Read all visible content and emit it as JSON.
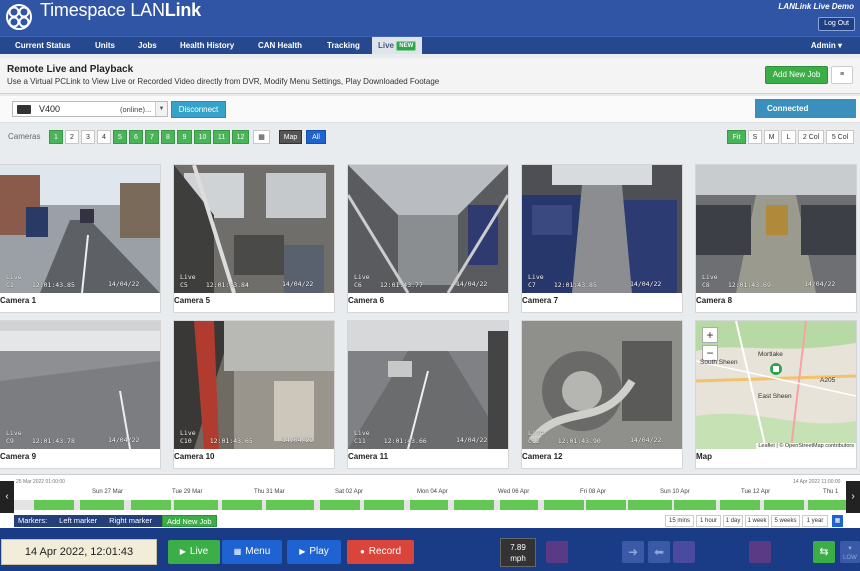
{
  "header": {
    "brand_prefix": "Timespace LAN",
    "brand_suffix": "Link",
    "demo_label": "LANLink Live Demo",
    "logout_label": "Log Out"
  },
  "nav": {
    "items": [
      "Current Status",
      "Units",
      "Jobs",
      "Health History",
      "CAN Health",
      "Tracking"
    ],
    "active_label": "Live",
    "active_badge": "NEW",
    "admin_label": "Admin ▾"
  },
  "page": {
    "title": "Remote Live and Playback",
    "subtitle": "Use a Virtual PCLink to View Live or Recorded Video directly from DVR, Modify Menu Settings, Play Downloaded Footage",
    "add_job_label": "Add New Job",
    "options_label": "≡"
  },
  "device": {
    "name": "V400",
    "status": "(online)...",
    "disconnect_label": "Disconnect",
    "connection_status": "Connected"
  },
  "cameras_bar": {
    "label": "Cameras",
    "numbers": [
      "1",
      "2",
      "3",
      "4",
      "5",
      "6",
      "7",
      "8",
      "9",
      "10",
      "11",
      "12"
    ],
    "active_numbers": [
      "1",
      "5",
      "6",
      "7",
      "8",
      "9",
      "10",
      "11",
      "12"
    ],
    "map_label": "Map",
    "all_label": "All",
    "sizes": [
      "Fit",
      "S",
      "M",
      "L",
      "2 Col",
      "5 Col"
    ],
    "active_size": "Fit"
  },
  "tiles": [
    {
      "caption": "Camera 1",
      "osd_live": "Live",
      "osd_ch": "C1",
      "osd_time": "12:01:43.85",
      "osd_date": "14/04/22"
    },
    {
      "caption": "Camera 5",
      "osd_live": "Live",
      "osd_ch": "C5",
      "osd_time": "12:01:43.84",
      "osd_date": "14/04/22"
    },
    {
      "caption": "Camera 6",
      "osd_live": "Live",
      "osd_ch": "C6",
      "osd_time": "12:01:43.77",
      "osd_date": "14/04/22"
    },
    {
      "caption": "Camera 7",
      "osd_live": "Live",
      "osd_ch": "C7",
      "osd_time": "12:01:43.85",
      "osd_date": "14/04/22"
    },
    {
      "caption": "Camera 8",
      "osd_live": "Live",
      "osd_ch": "C8",
      "osd_time": "12:01:43.69",
      "osd_date": "14/04/22"
    },
    {
      "caption": "Camera 9",
      "osd_live": "Live",
      "osd_ch": "C9",
      "osd_time": "12:01:43.78",
      "osd_date": "14/04/22"
    },
    {
      "caption": "Camera 10",
      "osd_live": "Live",
      "osd_ch": "C10",
      "osd_time": "12:01:43.65",
      "osd_date": "14/04/22"
    },
    {
      "caption": "Camera 11",
      "osd_live": "Live",
      "osd_ch": "C11",
      "osd_time": "12:01:43.66",
      "osd_date": "14/04/22"
    },
    {
      "caption": "Camera 12",
      "osd_live": "Live",
      "osd_ch": "C12",
      "osd_time": "12:01:43.90",
      "osd_date": "14/04/22"
    },
    {
      "caption": "Map"
    }
  ],
  "map": {
    "labels": [
      "Mortlake",
      "East Sheen",
      "South Sheen",
      "A205"
    ],
    "attribution": "Leaflet | © OpenStreetMap contributors"
  },
  "timeline": {
    "start_small": "25 Mar 2022 01:00:00",
    "end_small": "14 Apr 2022 11:00:00",
    "ticks": [
      "Sun 27 Mar",
      "Tue 29 Mar",
      "Thu 31 Mar",
      "Sat 02 Apr",
      "Mon 04 Apr",
      "Wed 06 Apr",
      "Fri 08 Apr",
      "Sun 10 Apr",
      "Tue 12 Apr",
      "Thu 1"
    ],
    "prev_label": "‹",
    "next_label": "›"
  },
  "markers": {
    "label": "Markers:",
    "left": "Left marker",
    "right": "Right marker",
    "add_job": "Add New Job"
  },
  "ranges": [
    "15 mins",
    "1 hour",
    "1 day",
    "1 week",
    "5 weeks",
    "1 year"
  ],
  "footer": {
    "datetime": "14 Apr 2022, 12:01:43",
    "live_label": "Live",
    "menu_label": "Menu",
    "play_label": "Play",
    "record_label": "Record",
    "speed_value": "7.89",
    "speed_unit": "mph",
    "low_label": "LOW"
  },
  "colors": {
    "header_blue": "#2f55a4",
    "accent_green": "#3cae48",
    "footer_blue": "#1a3b86",
    "record_red": "#d9443b"
  }
}
